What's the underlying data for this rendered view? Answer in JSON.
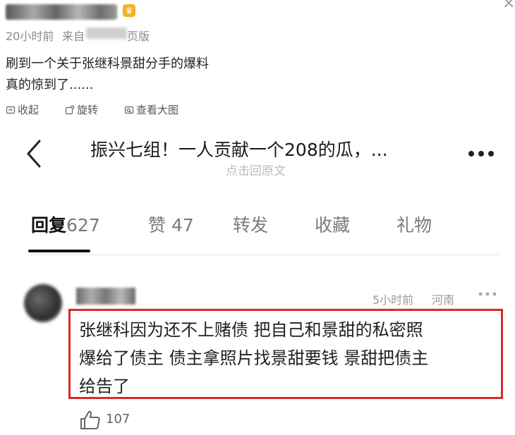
{
  "post": {
    "vip_badge": "♛",
    "time": "20小时前",
    "source_prefix": "来自",
    "source_suffix": "页版",
    "line1": "刷到一个关于张继科景甜分手的爆料",
    "line2": "真的惊到了......",
    "toolbar": {
      "collapse": "收起",
      "rotate": "旋转",
      "view_large": "查看大图"
    }
  },
  "screenshot": {
    "title": "振兴七组！一人贡献一个208的瓜，...",
    "subtitle": "点击回原文",
    "tabs": [
      {
        "label": "回复",
        "count": "627"
      },
      {
        "label": "赞",
        "count": "47"
      },
      {
        "label": "转发",
        "count": ""
      },
      {
        "label": "收藏",
        "count": ""
      },
      {
        "label": "礼物",
        "count": ""
      }
    ],
    "comment": {
      "time": "5小时前",
      "location": "河南",
      "lines": [
        "张继科因为还不上赌债 把自己和景甜的私密照",
        "爆给了债主 债主拿照片找景甜要钱 景甜把债主",
        "给告了"
      ],
      "likes": "107"
    }
  },
  "colors": {
    "highlight_border": "#d92a2a",
    "vip_badge": "#f0b429",
    "muted_text": "#8a8a8a"
  }
}
